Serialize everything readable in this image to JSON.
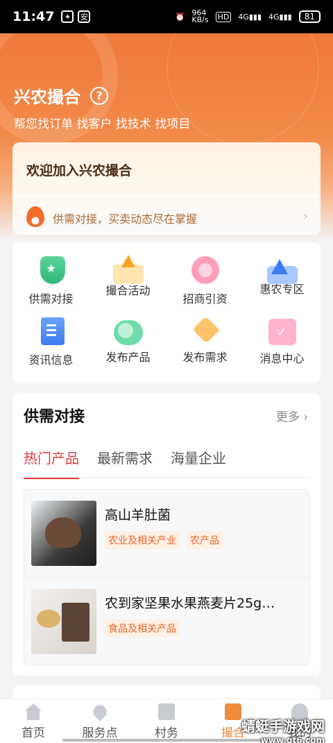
{
  "status_bar": {
    "time": "11:47",
    "net_speed": "964\nKB/s",
    "signal_label": "4G",
    "battery": "81"
  },
  "header": {
    "title": "兴农撮合",
    "help_icon": "?",
    "subtitle": "帮您找订单 找客户 找技术 找项目"
  },
  "welcome": {
    "title": "欢迎加入兴农撮合",
    "ticker": "供需对接，买卖动态尽在掌握",
    "chevron": "›"
  },
  "services": [
    {
      "label": "供需对接",
      "icon": "supply-demand-icon"
    },
    {
      "label": "撮合活动",
      "icon": "matchmaking-activity-icon"
    },
    {
      "label": "招商引资",
      "icon": "investment-icon"
    },
    {
      "label": "惠农专区",
      "icon": "agri-benefit-icon"
    },
    {
      "label": "资讯信息",
      "icon": "news-icon"
    },
    {
      "label": "发布产品",
      "icon": "publish-product-icon"
    },
    {
      "label": "发布需求",
      "icon": "publish-demand-icon"
    },
    {
      "label": "消息中心",
      "icon": "message-center-icon"
    }
  ],
  "supply_section": {
    "title": "供需对接",
    "more": "更多 ›",
    "tabs": [
      "热门产品",
      "最新需求",
      "海量企业"
    ],
    "products": [
      {
        "name": "高山羊肚菌",
        "tags": [
          "农业及相关产业",
          "农产品"
        ]
      },
      {
        "name": "农到家坚果水果燕麦片25g…",
        "tags": [
          "食品及相关产品"
        ]
      }
    ]
  },
  "tabbar": [
    {
      "label": "首页",
      "icon": "home-icon",
      "active": false
    },
    {
      "label": "服务点",
      "icon": "location-icon",
      "active": false
    },
    {
      "label": "村务",
      "icon": "village-icon",
      "active": false
    },
    {
      "label": "撮合",
      "icon": "matchmaking-bag-icon",
      "active": true
    },
    {
      "label": "我的",
      "icon": "user-icon",
      "active": false
    }
  ],
  "watermark": {
    "text": "蜻蜓手游戏网",
    "url": "www.qt6.com"
  },
  "colors": {
    "accent": "#f08a3c",
    "tab_active": "#e33b3b",
    "tag_text": "#e8672b"
  }
}
